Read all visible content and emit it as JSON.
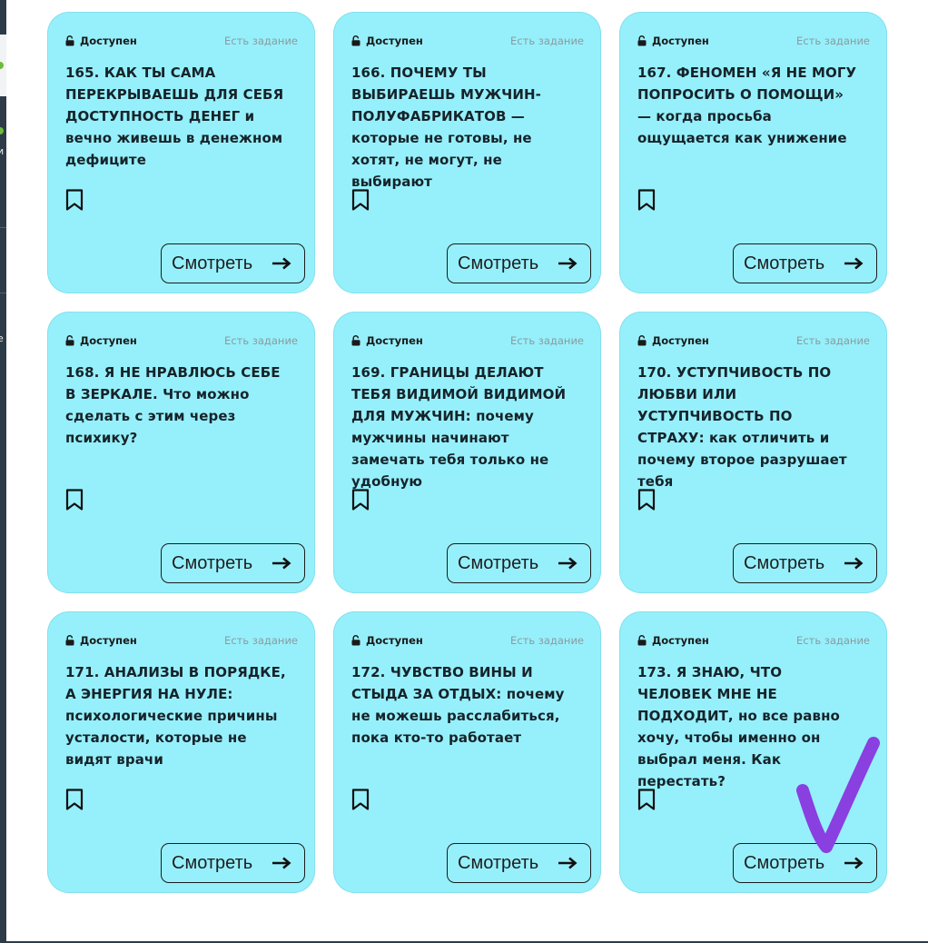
{
  "sidebar_fragment": {
    "glyph_1": "и",
    "glyph_2": "е"
  },
  "cards": [
    {
      "status": "Доступен",
      "task_label": "Есть задание",
      "title": "165. КАК ТЫ САМА ПЕРЕКРЫВАЕШЬ ДЛЯ СЕБЯ ДОСТУПНОСТЬ ДЕНЕГ и вечно живешь в денежном дефиците",
      "button_label": "Смотреть"
    },
    {
      "status": "Доступен",
      "task_label": "Есть задание",
      "title": "166. ПОЧЕМУ ТЫ ВЫБИРАЕШЬ МУЖЧИН-ПОЛУФАБРИКАТОВ — которые не готовы, не хотят, не могут, не выбирают",
      "button_label": "Смотреть"
    },
    {
      "status": "Доступен",
      "task_label": "Есть задание",
      "title": "167. ФЕНОМЕН «Я НЕ МОГУ ПОПРОСИТЬ О ПОМОЩИ» — когда просьба ощущается как унижение",
      "button_label": "Смотреть"
    },
    {
      "status": "Доступен",
      "task_label": "Есть задание",
      "title": "168. Я НЕ НРАВЛЮСЬ СЕБЕ В ЗЕРКАЛЕ. Что можно сделать с этим через психику?",
      "button_label": "Смотреть"
    },
    {
      "status": "Доступен",
      "task_label": "Есть задание",
      "title": "169. ГРАНИЦЫ ДЕЛАЮТ ТЕБЯ ВИДИМОЙ ВИДИМОЙ ДЛЯ МУЖЧИН: почему мужчины начинают замечать тебя только не удобную",
      "button_label": "Смотреть"
    },
    {
      "status": "Доступен",
      "task_label": "Есть задание",
      "title": "170. УСТУПЧИВОСТЬ ПО ЛЮБВИ ИЛИ УСТУПЧИВОСТЬ ПО СТРАХУ: как отличить и почему второе разрушает тебя",
      "button_label": "Смотреть"
    },
    {
      "status": "Доступен",
      "task_label": "Есть задание",
      "title": "171. АНАЛИЗЫ В ПОРЯДКЕ, А ЭНЕРГИЯ НА НУЛЕ: психологические причины усталости, которые не видят врачи",
      "button_label": "Смотреть"
    },
    {
      "status": "Доступен",
      "task_label": "Есть задание",
      "title": "172. ЧУВСТВО ВИНЫ И СТЫДА ЗА ОТДЫХ: почему не можешь расслабиться, пока кто-то работает",
      "button_label": "Смотреть"
    },
    {
      "status": "Доступен",
      "task_label": "Есть задание",
      "title": "173. Я ЗНАЮ, ЧТО ЧЕЛОВЕК МНЕ НЕ ПОДХОДИТ, но все равно хочу, чтобы именно он выбрал меня. Как перестать?",
      "button_label": "Смотреть"
    }
  ],
  "colors": {
    "card_background": "#96f0fb",
    "text": "#16232a",
    "muted_label": "#8a9aa0",
    "checkmark": "#8a3fe0"
  }
}
